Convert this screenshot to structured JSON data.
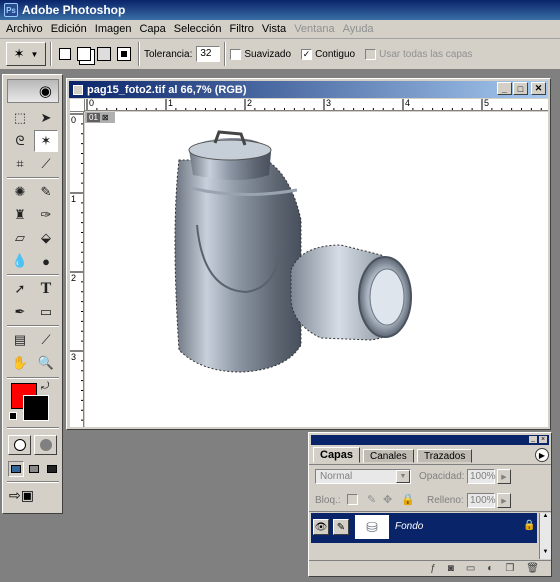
{
  "app": {
    "title": "Adobe Photoshop",
    "logo": "ps-logo"
  },
  "menu": [
    "Archivo",
    "Edición",
    "Imagen",
    "Capa",
    "Selección",
    "Filtro",
    "Vista"
  ],
  "menu_disabled": [
    "Ventana",
    "Ayuda"
  ],
  "options": {
    "tolerance_label": "Tolerancia:",
    "tolerance_value": "32",
    "antialias_label": "Suavizado",
    "contiguous_label": "Contiguo",
    "alllayers_label": "Usar todas las capas"
  },
  "document": {
    "title": "pag15_foto2.tif al 66,7% (RGB)",
    "hruler_ticks": [
      "0",
      "1",
      "2",
      "3",
      "4",
      "5"
    ],
    "vruler_ticks": [
      "0",
      "1",
      "2",
      "3"
    ],
    "layer_chip": "01"
  },
  "layers_panel": {
    "tabs": [
      "Capas",
      "Canales",
      "Trazados"
    ],
    "blend_mode": "Normal",
    "opacity_label": "Opacidad:",
    "opacity_value": "100%",
    "lock_label": "Bloq.:",
    "fill_label": "Relleno:",
    "fill_value": "100%",
    "layer_name": "Fondo"
  },
  "colors": {
    "foreground": "#ff0000",
    "background": "#000000",
    "accent": "#0a246a"
  }
}
